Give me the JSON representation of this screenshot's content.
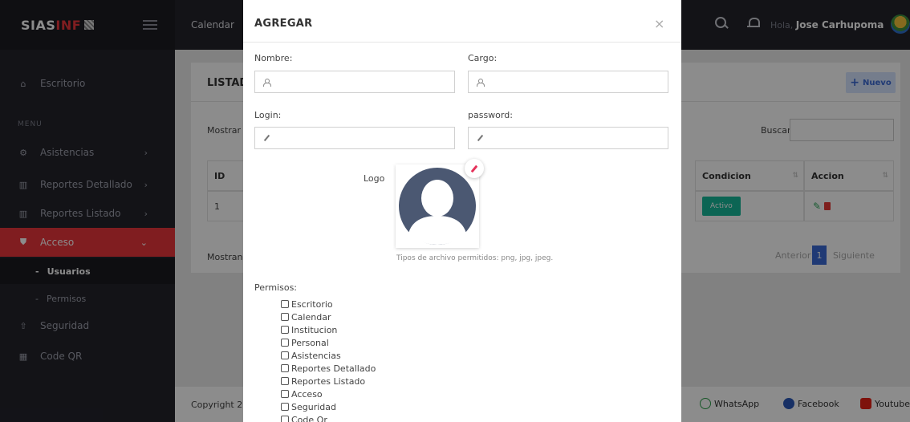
{
  "brand": {
    "name_prefix": "SIAS",
    "name_accent": "INF"
  },
  "sidebar": {
    "escritorio": "Escritorio",
    "section": "MENU",
    "items": [
      {
        "label": "Asistencias"
      },
      {
        "label": "Reportes Detallado"
      },
      {
        "label": "Reportes Listado"
      },
      {
        "label": "Acceso"
      }
    ],
    "sub_items": [
      {
        "label": "Usuarios"
      },
      {
        "label": "Permisos"
      }
    ],
    "items_after": [
      {
        "label": "Seguridad"
      },
      {
        "label": "Code QR"
      }
    ]
  },
  "topbar": {
    "calendar": "Calendar",
    "greeting": "Hola,",
    "user_name": "Jose Carhupoma"
  },
  "page": {
    "title": "LISTAD",
    "new_button": "Nuevo",
    "show_top": "Mostrar",
    "search_label": "Buscar:",
    "columns": {
      "id": "ID",
      "condicion": "Condicion",
      "accion": "Accion"
    },
    "row": {
      "id": "1",
      "status": "Activo"
    },
    "show_bottom": "Mostran",
    "pager": {
      "prev": "Anterior",
      "current": "1",
      "next": "Siguiente"
    },
    "footer_copy": "Copyright 2",
    "social": {
      "whatsapp": "WhatsApp",
      "facebook": "Facebook",
      "youtube": "Youtube"
    }
  },
  "modal": {
    "title": "AGREGAR",
    "close": "×",
    "fields": {
      "nombre": {
        "label": "Nombre:",
        "value": ""
      },
      "cargo": {
        "label": "Cargo:",
        "value": ""
      },
      "login": {
        "label": "Login:",
        "value": ""
      },
      "password": {
        "label": "password:",
        "value": ""
      }
    },
    "logo_label": "Logo",
    "file_hint": "Tipos de archivo permitidos: png, jpg, jpeg.",
    "permissions_title": "Permisos:",
    "permissions": [
      "Escritorio",
      "Calendar",
      "Institucion",
      "Personal",
      "Asistencias",
      "Reportes Detallado",
      "Reportes Listado",
      "Acceso",
      "Seguridad",
      "Code Qr"
    ]
  },
  "colors": {
    "accent_red": "#e9353b",
    "sidebar_bg": "#23232b",
    "status_green": "#17b89a",
    "primary_blue": "#3b6bd6"
  }
}
